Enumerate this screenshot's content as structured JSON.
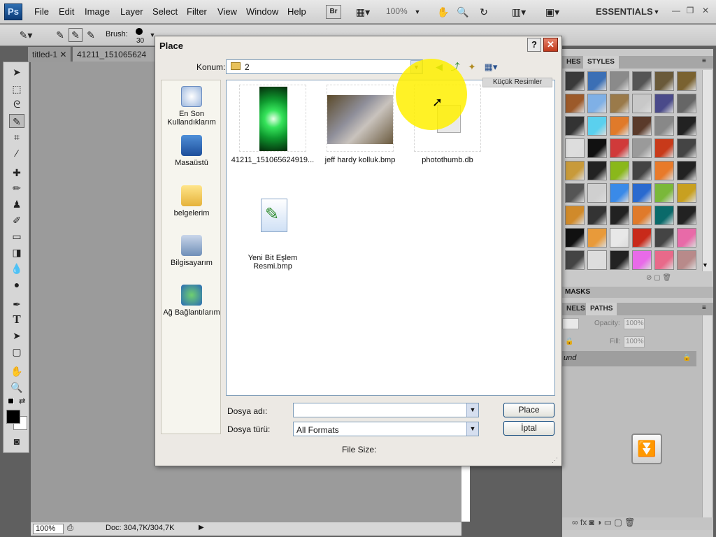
{
  "app": {
    "logo": "Ps"
  },
  "menu": [
    "File",
    "Edit",
    "Image",
    "Layer",
    "Select",
    "Filter",
    "View",
    "Window",
    "Help"
  ],
  "toolbar": {
    "br_label": "Br",
    "zoom": "100%",
    "workspace": "ESSENTIALS"
  },
  "options": {
    "brush_label": "Brush:",
    "brush_size": "30"
  },
  "doc_tabs": [
    "titled-1",
    "41211_151065624"
  ],
  "status": {
    "zoom": "100%",
    "doc": "Doc: 304,7K/304,7K"
  },
  "panels": {
    "styles_tabs": [
      "HES",
      "STYLES"
    ],
    "masks": "MASKS",
    "layers_tabs": [
      "NELS",
      "PATHS"
    ],
    "opacity_label": "Opacity:",
    "opacity": "100%",
    "fill_label": "Fill:",
    "fill": "100%",
    "layer_name": "und"
  },
  "dialog": {
    "title": "Place",
    "help": "?",
    "close": "✕",
    "konum_label": "Konum:",
    "konum_value": "2",
    "view_tooltip": "Küçük Resimler",
    "places": [
      "En Son Kullandıklarım",
      "Masaüstü",
      "belgelerim",
      "Bilgisayarım",
      "Ağ Bağlantılarım"
    ],
    "files": [
      "41211_151065624919...",
      "jeff hardy kolluk.bmp",
      "photothumb.db",
      "Yeni Bit Eşlem Resmi.bmp"
    ],
    "dosya_adi_label": "Dosya adı:",
    "dosya_adi_value": "",
    "dosya_turu_label": "Dosya türü:",
    "dosya_turu_value": "All Formats",
    "place_btn": "Place",
    "iptal_btn": "İptal",
    "file_size_label": "File Size:"
  }
}
